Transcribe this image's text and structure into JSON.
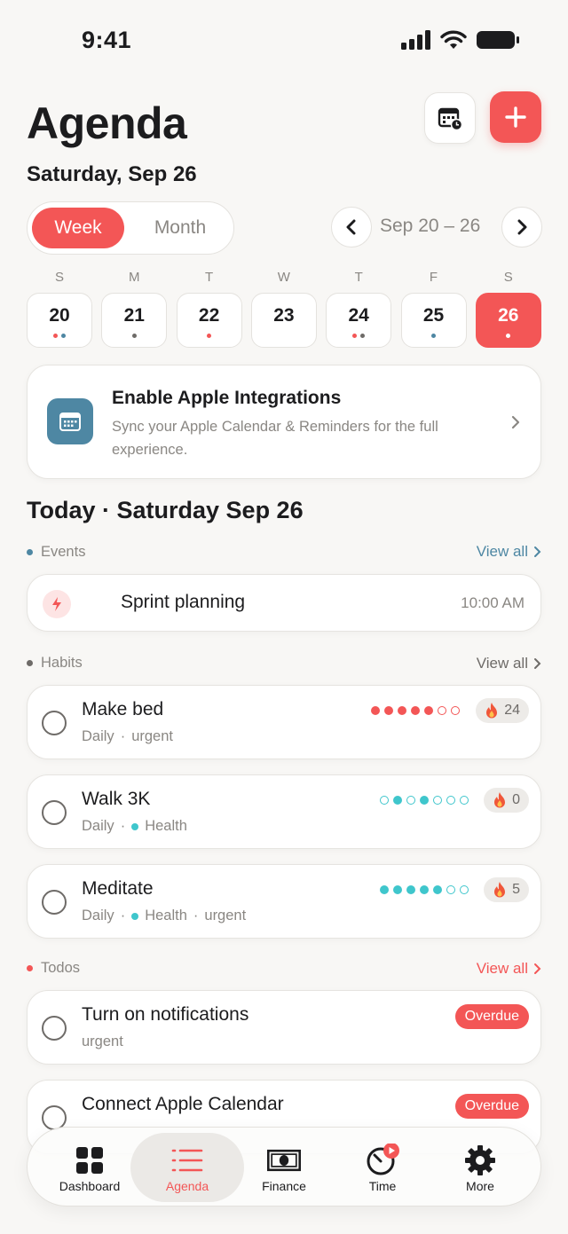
{
  "status_bar": {
    "time": "9:41"
  },
  "header": {
    "title": "Agenda",
    "date": "Saturday, Sep 26"
  },
  "view_toggle": {
    "week": "Week",
    "month": "Month",
    "selected": "Week"
  },
  "range": {
    "label": "Sep 20 – 26"
  },
  "week": {
    "days": [
      {
        "letter": "S",
        "num": "20",
        "dots": [
          "#f35656",
          "#4e87a3"
        ]
      },
      {
        "letter": "M",
        "num": "21",
        "dots": [
          "#6e6b68"
        ]
      },
      {
        "letter": "T",
        "num": "22",
        "dots": [
          "#f35656"
        ]
      },
      {
        "letter": "W",
        "num": "23",
        "dots": []
      },
      {
        "letter": "T",
        "num": "24",
        "dots": [
          "#f35656",
          "#6e6b68"
        ]
      },
      {
        "letter": "F",
        "num": "25",
        "dots": [
          "#4e87a3"
        ]
      },
      {
        "letter": "S",
        "num": "26",
        "dots": [
          "#ffffff"
        ],
        "selected": true
      }
    ]
  },
  "integration_banner": {
    "title": "Enable Apple Integrations",
    "description": "Sync your Apple Calendar & Reminders for the full experience."
  },
  "today": {
    "title": "Today · Saturday Sep 26"
  },
  "events": {
    "label": "Events",
    "view_all": "View all",
    "items": [
      {
        "title": "Sprint planning",
        "time": "10:00 AM"
      }
    ]
  },
  "habits": {
    "label": "Habits",
    "view_all": "View all",
    "items": [
      {
        "title": "Make bed",
        "frequency": "Daily",
        "tag": "",
        "extra": "urgent",
        "streak": "24",
        "color": "#f35656",
        "history": [
          1,
          1,
          1,
          1,
          1,
          0,
          0
        ]
      },
      {
        "title": "Walk 3K",
        "frequency": "Daily",
        "tag": "Health",
        "extra": "",
        "streak": "0",
        "color": "#3fc6cc",
        "history": [
          0,
          1,
          0,
          1,
          0,
          0,
          0
        ]
      },
      {
        "title": "Meditate",
        "frequency": "Daily",
        "tag": "Health",
        "extra": "urgent",
        "streak": "5",
        "color": "#3fc6cc",
        "history": [
          1,
          1,
          1,
          1,
          1,
          0,
          0
        ]
      }
    ]
  },
  "todos": {
    "label": "Todos",
    "view_all": "View all",
    "items": [
      {
        "title": "Turn on notifications",
        "meta": "urgent",
        "badge": "Overdue"
      },
      {
        "title": "Connect Apple Calendar",
        "meta": "",
        "badge": "Overdue"
      }
    ]
  },
  "tabbar": {
    "tabs": [
      {
        "label": "Dashboard",
        "icon": "grid-icon"
      },
      {
        "label": "Agenda",
        "icon": "list-icon",
        "active": true
      },
      {
        "label": "Finance",
        "icon": "banknote-icon"
      },
      {
        "label": "Time",
        "icon": "timer-icon"
      },
      {
        "label": "More",
        "icon": "gear-icon"
      }
    ]
  },
  "colors": {
    "accent": "#f35656",
    "teal": "#3fc6cc",
    "blue": "#4e87a3",
    "muted": "#8a8783"
  }
}
